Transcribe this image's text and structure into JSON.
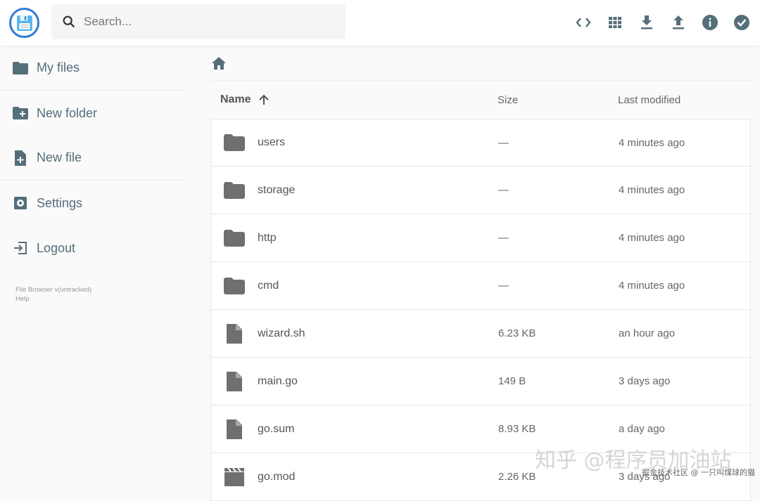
{
  "header": {
    "search_placeholder": "Search...",
    "accent": "#2f7bd6",
    "actions": [
      "code-view-icon",
      "grid-view-icon",
      "download-icon",
      "upload-icon",
      "info-icon",
      "select-check-icon"
    ]
  },
  "sidebar": {
    "items": [
      {
        "label": "My files",
        "icon": "folder-icon"
      },
      {
        "label": "New folder",
        "icon": "new-folder-icon"
      },
      {
        "label": "New file",
        "icon": "new-file-icon"
      },
      {
        "label": "Settings",
        "icon": "settings-icon"
      },
      {
        "label": "Logout",
        "icon": "logout-icon"
      }
    ],
    "credits": "File Browser v(untracked)",
    "help": "Help"
  },
  "list": {
    "headers": {
      "name": "Name",
      "size": "Size",
      "modified": "Last modified"
    },
    "rows": [
      {
        "name": "users",
        "type": "folder",
        "size": "—",
        "modified": "4 minutes ago"
      },
      {
        "name": "storage",
        "type": "folder",
        "size": "—",
        "modified": "4 minutes ago"
      },
      {
        "name": "http",
        "type": "folder",
        "size": "—",
        "modified": "4 minutes ago"
      },
      {
        "name": "cmd",
        "type": "folder",
        "size": "—",
        "modified": "4 minutes ago"
      },
      {
        "name": "wizard.sh",
        "type": "file",
        "size": "6.23 KB",
        "modified": "an hour ago"
      },
      {
        "name": "main.go",
        "type": "file",
        "size": "149 B",
        "modified": "3 days ago"
      },
      {
        "name": "go.sum",
        "type": "file",
        "size": "8.93 KB",
        "modified": "a day ago"
      },
      {
        "name": "go.mod",
        "type": "video",
        "size": "2.26 KB",
        "modified": "3 days ago"
      }
    ]
  },
  "watermark": {
    "main": "知乎 @程序员加油站",
    "sub": "掘金技术社区 @ 一只叫煤球的猫"
  }
}
